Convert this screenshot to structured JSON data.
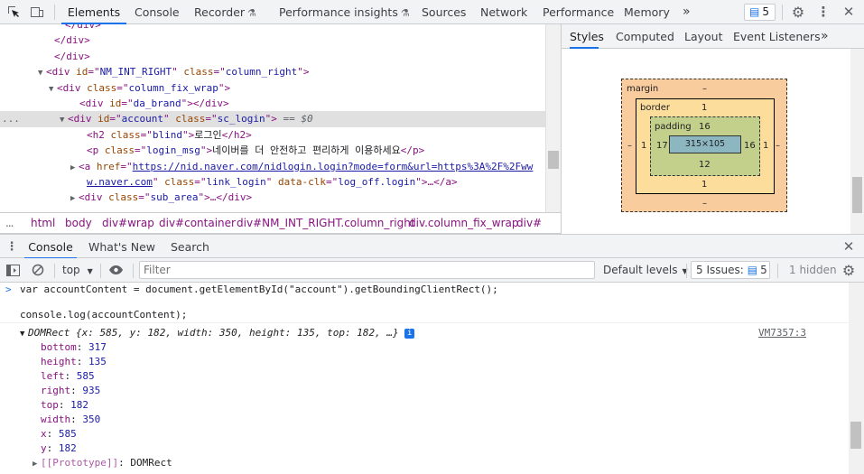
{
  "main_tabs": [
    "Elements",
    "Console",
    "Recorder",
    "Performance insights",
    "Sources",
    "Network",
    "Performance",
    "Memory"
  ],
  "more_tabs_glyph": "»",
  "issues_count": "5",
  "dom_tree": {
    "lines": [
      {
        "parts": [
          [
            "tag",
            "</div>"
          ]
        ]
      },
      {
        "parts": [
          [
            "tag",
            "</div>"
          ]
        ]
      },
      {
        "parts": [
          [
            "tag",
            "</div>"
          ]
        ]
      },
      {
        "tri": "▼",
        "parts": [
          [
            "tag",
            "<div "
          ],
          [
            "an",
            "id"
          ],
          [
            "tag",
            "=\""
          ],
          [
            "av",
            "NM_INT_RIGHT"
          ],
          [
            "tag",
            "\" "
          ],
          [
            "an",
            "class"
          ],
          [
            "tag",
            "=\""
          ],
          [
            "av",
            "column_right"
          ],
          [
            "tag",
            "\">"
          ]
        ]
      },
      {
        "tri": "▼",
        "parts": [
          [
            "tag",
            "<div "
          ],
          [
            "an",
            "class"
          ],
          [
            "tag",
            "=\""
          ],
          [
            "av",
            "column_fix_wrap"
          ],
          [
            "tag",
            "\">"
          ]
        ]
      },
      {
        "parts": [
          [
            "tag",
            "<div "
          ],
          [
            "an",
            "id"
          ],
          [
            "tag",
            "=\""
          ],
          [
            "av",
            "da_brand"
          ],
          [
            "tag",
            "\"></div>"
          ]
        ]
      },
      {
        "tri": "▼",
        "sel": true,
        "parts": [
          [
            "tag",
            "<div "
          ],
          [
            "an",
            "id"
          ],
          [
            "tag",
            "=\""
          ],
          [
            "av",
            "account"
          ],
          [
            "tag",
            "\" "
          ],
          [
            "an",
            "class"
          ],
          [
            "tag",
            "=\""
          ],
          [
            "av",
            "sc_login"
          ],
          [
            "tag",
            "\">"
          ],
          [
            "eqd",
            " == $0"
          ]
        ]
      },
      {
        "parts": [
          [
            "tag",
            "<h2 "
          ],
          [
            "an",
            "class"
          ],
          [
            "tag",
            "=\""
          ],
          [
            "av",
            "blind"
          ],
          [
            "tag",
            "\">"
          ],
          [
            "txt",
            "로그인"
          ],
          [
            "tag",
            "</h2>"
          ]
        ]
      },
      {
        "parts": [
          [
            "tag",
            "<p "
          ],
          [
            "an",
            "class"
          ],
          [
            "tag",
            "=\""
          ],
          [
            "av",
            "login_msg"
          ],
          [
            "tag",
            "\">"
          ],
          [
            "txt",
            "네이버를 더 안전하고 편리하게 이용하세요"
          ],
          [
            "tag",
            "</p>"
          ]
        ]
      },
      {
        "tri": "▶",
        "parts": [
          [
            "tag",
            "<a "
          ],
          [
            "an",
            "href"
          ],
          [
            "tag",
            "=\""
          ],
          [
            "lnk",
            "https://nid.naver.com/nidlogin.login?mode=form&url=https%3A%2F%2Fww"
          ]
        ]
      },
      {
        "parts": [
          [
            "lnk",
            "w.naver.com"
          ],
          [
            "tag",
            "\" "
          ],
          [
            "an",
            "class"
          ],
          [
            "tag",
            "=\""
          ],
          [
            "av",
            "link_login"
          ],
          [
            "tag",
            "\" "
          ],
          [
            "an",
            "data-clk"
          ],
          [
            "tag",
            "=\""
          ],
          [
            "av",
            "log_off.login"
          ],
          [
            "tag",
            "\">…</a>"
          ]
        ]
      },
      {
        "tri": "▶",
        "parts": [
          [
            "tag",
            "<div "
          ],
          [
            "an",
            "class"
          ],
          [
            "tag",
            "=\""
          ],
          [
            "av",
            "sub_area"
          ],
          [
            "tag",
            "\">…</div>"
          ]
        ]
      }
    ],
    "row_dots": "..."
  },
  "breadcrumbs": [
    "html",
    "body",
    "div#wrap",
    "div#container",
    "div#NM_INT_RIGHT.column_right",
    "div.column_fix_wrap",
    "div#"
  ],
  "styles_tabs": [
    "Styles",
    "Computed",
    "Layout",
    "Event Listeners"
  ],
  "box_model": {
    "margin_label": "margin",
    "margin_top": "–",
    "margin_bottom": "–",
    "margin_left": "–",
    "margin_right": "–",
    "border_label": "border",
    "border_top": "1",
    "border_bottom": "1",
    "border_left": "1",
    "border_right": "1",
    "padding_label": "padding",
    "padding_top": "16",
    "padding_bottom": "12",
    "padding_left": "17",
    "padding_right": "16",
    "content": "315×105"
  },
  "drawer_tabs": [
    "Console",
    "What's New",
    "Search"
  ],
  "console_toolbar": {
    "context": "top",
    "filter_placeholder": "Filter",
    "levels": "Default levels",
    "issues_label": "5 Issues:",
    "issues_count": "5",
    "hidden": "1 hidden"
  },
  "console": {
    "input_line1": "var accountContent = document.getElementById(\"account\").getBoundingClientRect();",
    "input_line2": "console.log(accountContent);",
    "summary_class": "DOMRect",
    "summary_body": "{x: 585, y: 182, width: 350, height: 135, top: 182, …}",
    "source_link": "VM7357:3",
    "properties": [
      {
        "key": "bottom",
        "value": "317"
      },
      {
        "key": "height",
        "value": "135"
      },
      {
        "key": "left",
        "value": "585"
      },
      {
        "key": "right",
        "value": "935"
      },
      {
        "key": "top",
        "value": "182"
      },
      {
        "key": "width",
        "value": "350"
      },
      {
        "key": "x",
        "value": "585"
      },
      {
        "key": "y",
        "value": "182"
      }
    ],
    "prototype_key": "[[Prototype]]",
    "prototype_value": "DOMRect"
  }
}
